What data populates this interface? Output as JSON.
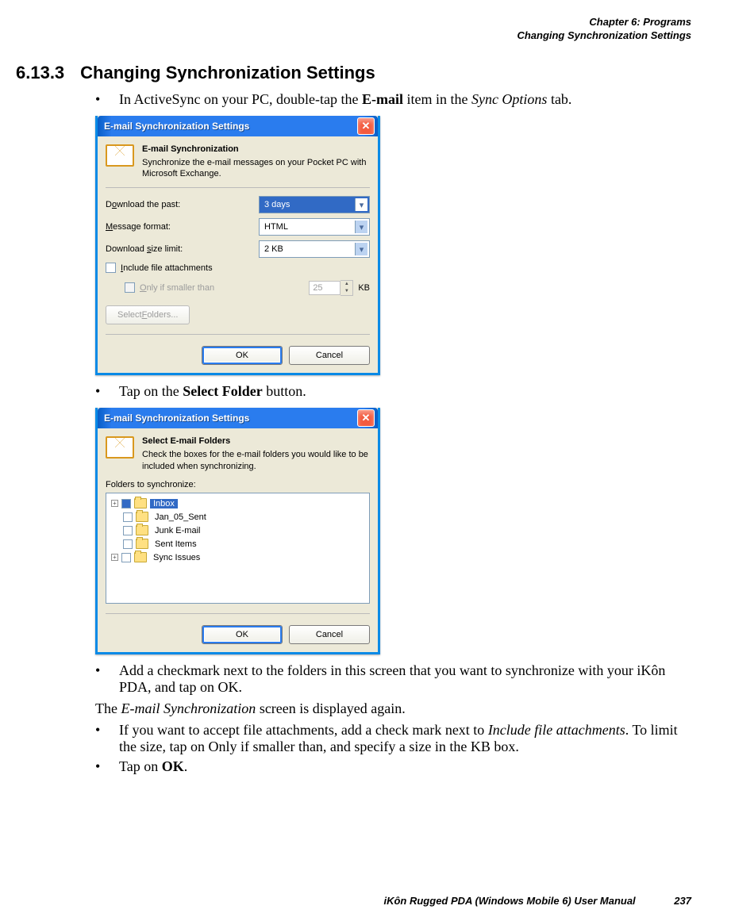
{
  "header": {
    "chapter": "Chapter 6: Programs",
    "section": "Changing Synchronization Settings"
  },
  "heading": {
    "number": "6.13.3",
    "title": "Changing Synchronization Settings"
  },
  "bullets1": {
    "pre": "In ActiveSync on your PC, double-tap the ",
    "bold": "E-mail",
    "mid": " item in the ",
    "italic": "Sync Options",
    "post": " tab."
  },
  "dialog1": {
    "title": "E-mail Synchronization Settings",
    "hdr_title": "E-mail Synchronization",
    "hdr_desc": "Synchronize the e-mail messages on your Pocket PC with Microsoft Exchange.",
    "row1": {
      "label_pre": "D",
      "label_u": "o",
      "label_post": "wnload the past:",
      "value": "3 days"
    },
    "row2": {
      "label_pre": "",
      "label_u": "M",
      "label_post": "essage format:",
      "value": "HTML"
    },
    "row3": {
      "label_pre": "Download ",
      "label_u": "s",
      "label_post": "ize limit:",
      "value": "2 KB"
    },
    "check1": {
      "label_pre": "",
      "label_u": "I",
      "label_post": "nclude file attachments"
    },
    "check2": {
      "label_pre": "",
      "label_u": "O",
      "label_post": "nly if smaller than",
      "value": "25",
      "unit": "KB"
    },
    "select_folders_pre": "Select ",
    "select_folders_u": "F",
    "select_folders_post": "olders...",
    "ok": "OK",
    "cancel": "Cancel"
  },
  "bullet2": {
    "pre": "Tap on the ",
    "bold": "Select Folder",
    "post": " button."
  },
  "dialog2": {
    "title": "E-mail Synchronization Settings",
    "hdr_title": "Select E-mail Folders",
    "hdr_desc": "Check the boxes for the e-mail folders you would like to be included when synchronizing.",
    "folders_label": "Folders to synchronize:",
    "tree": [
      {
        "exp": "+",
        "checked": true,
        "label": "Inbox",
        "selected": true
      },
      {
        "exp": "",
        "checked": false,
        "label": "Jan_05_Sent"
      },
      {
        "exp": "",
        "checked": false,
        "label": "Junk E-mail"
      },
      {
        "exp": "",
        "checked": false,
        "label": "Sent Items"
      },
      {
        "exp": "+",
        "checked": false,
        "label": "Sync Issues"
      }
    ],
    "ok": "OK",
    "cancel": "Cancel"
  },
  "bullet3": "Add a checkmark next to the folders in this screen that you want to synchronize with your iKôn PDA, and tap on OK.",
  "para1": {
    "pre": "The ",
    "italic": "E-mail Synchronization",
    "post": " screen is displayed again."
  },
  "bullet4": {
    "pre": "If you want to accept file attachments, add a check mark next to ",
    "italic": "Include file attachments",
    "post": ". To limit the size, tap on Only if smaller than, and specify a size in the KB box."
  },
  "bullet5": {
    "pre": "Tap on ",
    "bold": "OK",
    "post": "."
  },
  "footer": {
    "title": "iKôn Rugged PDA (Windows Mobile 6) User Manual",
    "page": "237"
  }
}
